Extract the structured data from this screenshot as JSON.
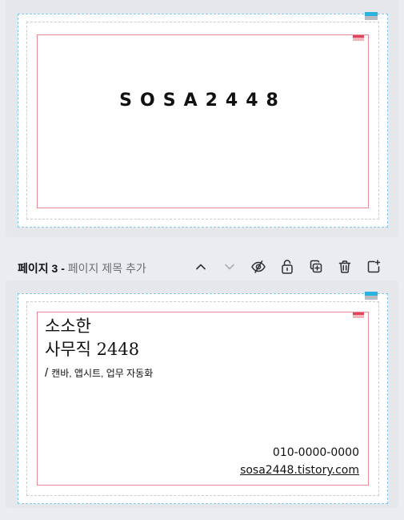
{
  "pages": [
    {
      "design": {
        "title_text": "SOSA2448"
      }
    },
    {
      "toolbar": {
        "page_number_label": "페이지 3",
        "separator": " - ",
        "title_placeholder": "페이지 제목 추가",
        "icons": [
          "chevron-up-icon",
          "chevron-down-icon",
          "eye-hidden-icon",
          "lock-open-icon",
          "duplicate-page-icon",
          "trash-icon",
          "add-page-icon"
        ]
      },
      "design": {
        "brand_line1": "소소한",
        "brand_line2": "사무직 2448",
        "tagline_slash": "/",
        "tagline": "캔바, 앱시트, 업무 자동화",
        "phone": "010-0000-0000",
        "website": "sosa2448.tistory.com"
      }
    }
  ],
  "colors": {
    "workspace_bg": "#ebecf0",
    "safe_area": "#e88a95",
    "bleed_guide": "#c9cdd3",
    "edge_guide": "#7fc8e6",
    "accent_blue": "#2bb3e0"
  }
}
